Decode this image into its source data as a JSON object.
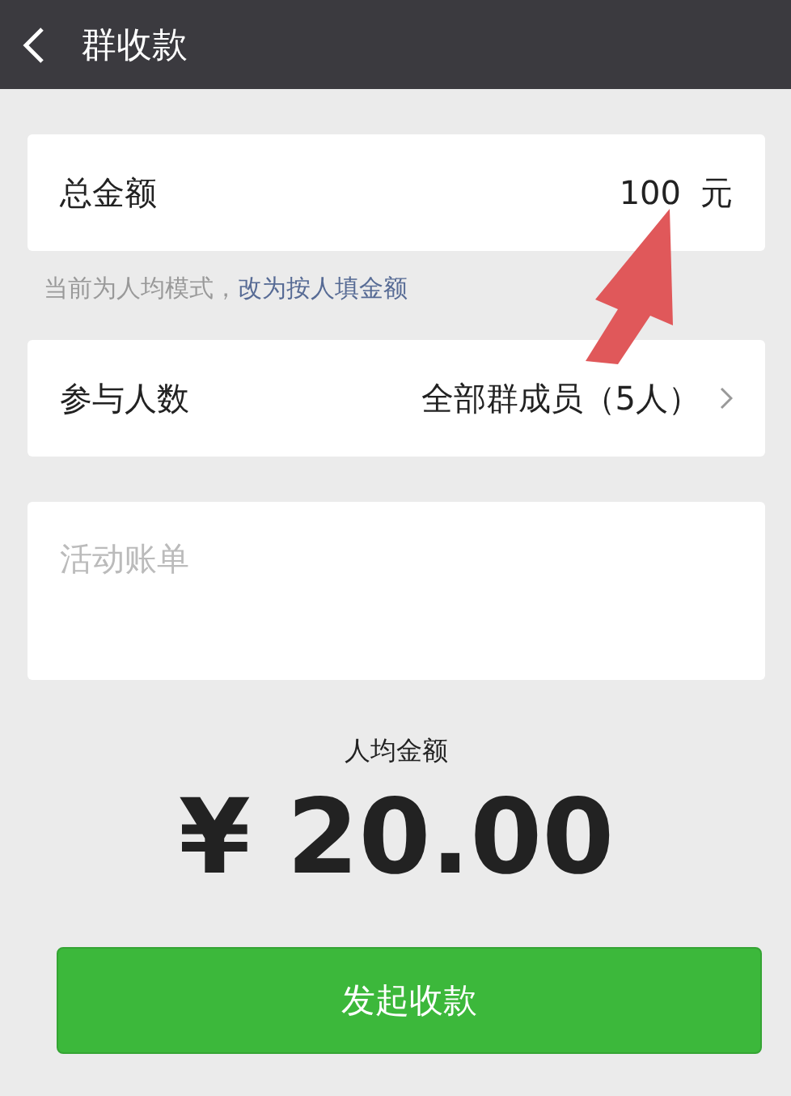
{
  "header": {
    "title": "群收款"
  },
  "total": {
    "label": "总金额",
    "value": "100",
    "unit": "元"
  },
  "hint": {
    "text": "当前为人均模式，",
    "link": "改为按人填金额"
  },
  "participants": {
    "label": "参与人数",
    "value": "全部群成员（5人）"
  },
  "bill": {
    "placeholder": "活动账单"
  },
  "per_person": {
    "label": "人均金额",
    "amount": "¥ 20.00"
  },
  "submit": {
    "label": "发起收款"
  }
}
